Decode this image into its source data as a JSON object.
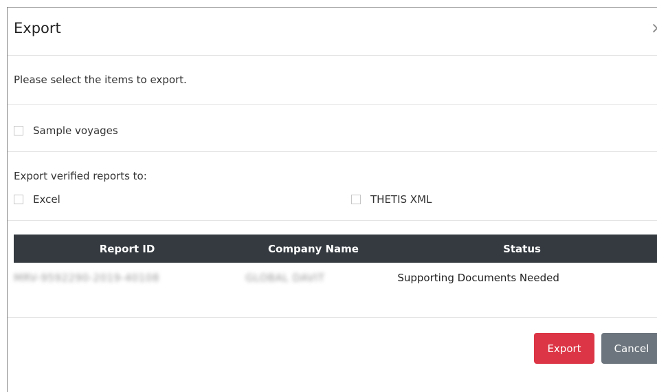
{
  "dialog": {
    "title": "Export",
    "close_symbol": "×"
  },
  "instruction": "Please select the items to export.",
  "sample_voyages_label": "Sample voyages",
  "export_section": {
    "label": "Export verified reports to:",
    "excel_label": "Excel",
    "thetis_label": "THETIS XML"
  },
  "table": {
    "headers": {
      "report_id": "Report ID",
      "company_name": "Company Name",
      "status": "Status"
    },
    "rows": [
      {
        "report_id": "MRV-9592290-2019-40108",
        "company_name": "GLOBAL DAVIT",
        "status": "Supporting Documents Needed"
      }
    ]
  },
  "buttons": {
    "export": "Export",
    "cancel": "Cancel"
  },
  "colors": {
    "table_header": "#343a40",
    "export_button": "#dc3545",
    "cancel_button": "#6c757d"
  }
}
